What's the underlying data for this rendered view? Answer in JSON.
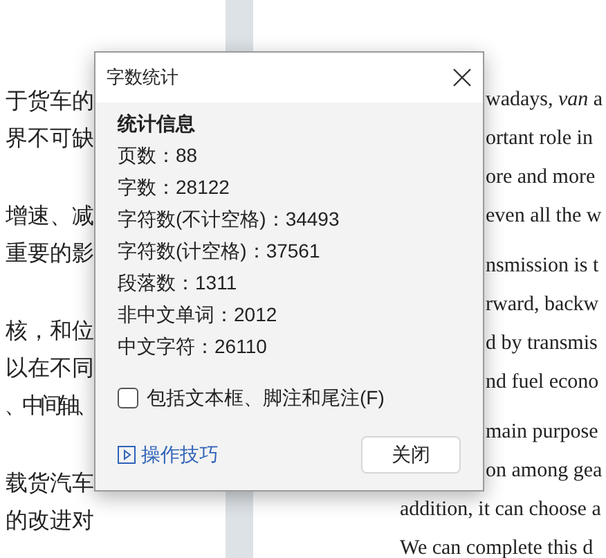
{
  "document": {
    "left_page": {
      "paragraphs": [
        [
          "于货车的",
          "界不可缺"
        ],
        [
          "增速、减",
          "重要的影"
        ],
        [
          "核，和位",
          "以在不同",
          "、中间轴、"
        ],
        [
          "载货汽车",
          "的改进对"
        ]
      ]
    },
    "right_page": {
      "paragraphs": [
        [
          "wadays, *van* a",
          "ortant role in",
          "ore and more",
          "even all the w"
        ],
        [
          "nsmission is t",
          "rward, backw",
          "d by transmis",
          "nd fuel econo"
        ],
        [
          "main purpose",
          "on among gea",
          "addition, it can choose a",
          "We can complete this d"
        ]
      ]
    }
  },
  "dialog": {
    "title": "字数统计",
    "heading": "统计信息",
    "stats": [
      "页数：88",
      "字数：28122",
      "字符数(不计空格)：34493",
      "字符数(计空格)：37561",
      "段落数：1311",
      "非中文单词：2012",
      "中文字符：26110"
    ],
    "option": {
      "label": "包括文本框、脚注和尾注(F)",
      "checked": false
    },
    "tips_link": "操作技巧",
    "close_button": "关闭"
  }
}
